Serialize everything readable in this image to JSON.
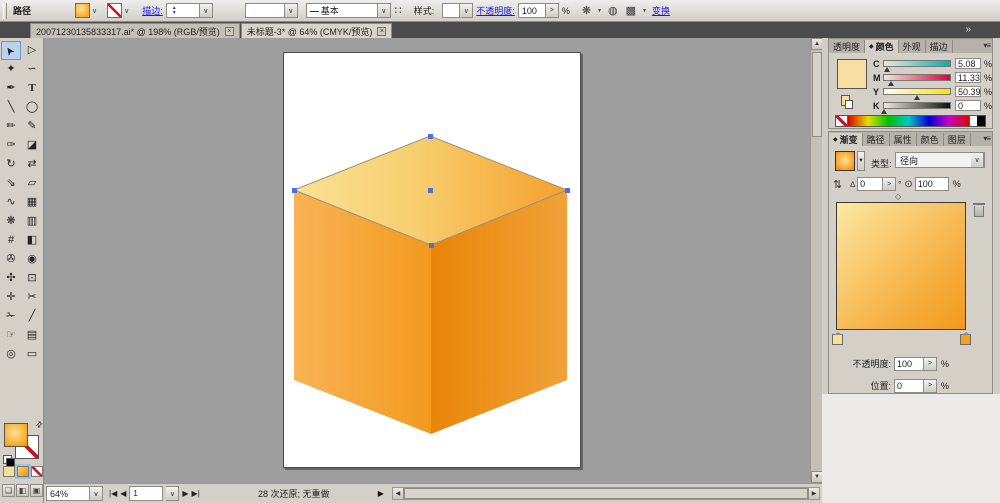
{
  "glyphs": {
    "dropdown_arrow": "∨",
    "spinner_right": ">",
    "percent": "%",
    "degree": "°",
    "menu": "▾≡",
    "collapse": "»",
    "up": "▲",
    "down": "▼",
    "nav_first": "|◀",
    "nav_prev": "◀",
    "nav_next": "▶",
    "nav_last": "▶|",
    "swap": "⇄",
    "midpoint": "◇",
    "reverse": "⇅",
    "angle": "∆",
    "aspect": "⊙",
    "active_marker": "◆",
    "brush_dots": "∷",
    "stroke_line": "—",
    "recolor": "❋",
    "sphere": "◍",
    "align_grid": "▩",
    "mode_normal": "❏",
    "mode_menu": "◧",
    "mode_full": "▣",
    "left_arrow": "◀",
    "right_arrow": "▶"
  },
  "control_bar": {
    "selection_label": "路径",
    "stroke_label": "描边:",
    "brush_name": "基本",
    "style_label": "样式:",
    "opacity_label": "不透明度:",
    "opacity_value": "100",
    "opacity_unit": "%",
    "transform_label": "变换"
  },
  "document_tabs": [
    {
      "title": "20071230135833317.ai* @ 198% (RGB/预览)",
      "close": "×"
    },
    {
      "title": "未标题-3* @ 64% (CMYK/预览)",
      "close": "×",
      "active": true
    }
  ],
  "toolbar": {
    "tools": [
      {
        "name": "selection-tool",
        "glyph": "➤",
        "active": true
      },
      {
        "name": "direct-selection-tool",
        "glyph": "▷"
      },
      {
        "name": "magic-wand-tool",
        "glyph": "✦"
      },
      {
        "name": "lasso-tool",
        "glyph": "∽"
      },
      {
        "name": "pen-tool",
        "glyph": "✒"
      },
      {
        "name": "type-tool",
        "glyph": "T"
      },
      {
        "name": "line-segment-tool",
        "glyph": "╲"
      },
      {
        "name": "ellipse-tool",
        "glyph": "◯"
      },
      {
        "name": "paintbrush-tool",
        "glyph": "✏"
      },
      {
        "name": "pencil-tool",
        "glyph": "✎"
      },
      {
        "name": "smooth-tool",
        "glyph": "✑"
      },
      {
        "name": "path-eraser-tool",
        "glyph": "◪"
      },
      {
        "name": "rotate-tool",
        "glyph": "↻"
      },
      {
        "name": "reflect-tool",
        "glyph": "⇄"
      },
      {
        "name": "scale-tool",
        "glyph": "⇘"
      },
      {
        "name": "shear-tool",
        "glyph": "▱"
      },
      {
        "name": "warp-tool",
        "glyph": "∿"
      },
      {
        "name": "free-transform-tool",
        "glyph": "▦"
      },
      {
        "name": "symbol-sprayer-tool",
        "glyph": "❋"
      },
      {
        "name": "column-graph-tool",
        "glyph": "▥"
      },
      {
        "name": "mesh-tool",
        "glyph": "#"
      },
      {
        "name": "gradient-tool",
        "glyph": "◧"
      },
      {
        "name": "eyedropper-tool",
        "glyph": "✇"
      },
      {
        "name": "blend-tool",
        "glyph": "◉"
      },
      {
        "name": "live-paint-bucket-tool",
        "glyph": "✣"
      },
      {
        "name": "live-paint-selection-tool",
        "glyph": "⊡"
      },
      {
        "name": "crop-area-tool",
        "glyph": "✛"
      },
      {
        "name": "slice-tool",
        "glyph": "✂"
      },
      {
        "name": "scissors-tool",
        "glyph": "✁"
      },
      {
        "name": "knife-tool",
        "glyph": "╱"
      },
      {
        "name": "hand-tool",
        "glyph": "☞"
      },
      {
        "name": "page-tool",
        "glyph": "▤"
      },
      {
        "name": "zoom-tool",
        "glyph": "◎"
      },
      {
        "name": "artboard-tool",
        "glyph": "▭"
      }
    ]
  },
  "status_bar": {
    "zoom_value": "64%",
    "page_value": "1",
    "undo_text": "28 次还原; 无重做"
  },
  "panels": {
    "color": {
      "tabs": [
        {
          "label": "透明度"
        },
        {
          "label": "颜色",
          "active": true
        },
        {
          "label": "外观"
        },
        {
          "label": "描边"
        }
      ],
      "swatch_color": "#F6DFA0",
      "channels": [
        {
          "label": "C",
          "value": "5.08",
          "unit": "%",
          "pct": 5
        },
        {
          "label": "M",
          "value": "11.33",
          "unit": "%",
          "pct": 11
        },
        {
          "label": "Y",
          "value": "50.39",
          "unit": "%",
          "pct": 50
        },
        {
          "label": "K",
          "value": "0",
          "unit": "%",
          "pct": 0
        }
      ]
    },
    "gradient": {
      "tabs": [
        {
          "label": "渐变",
          "active": true
        },
        {
          "label": "路径"
        },
        {
          "label": "属性"
        },
        {
          "label": "颜色"
        },
        {
          "label": "图层"
        }
      ],
      "type_label": "类型:",
      "type_value": "径向",
      "angle_value": "0",
      "aspect_value": "100",
      "opacity_label": "不透明度:",
      "opacity_value": "100",
      "location_label": "位置:",
      "location_value": "0",
      "stop_colors": [
        "#F7E392",
        "#F5A21F"
      ]
    }
  },
  "artwork": {
    "description": "orange gradient cube with selected top face",
    "top_face_gradient": [
      "#F9E294",
      "#F4A02A"
    ],
    "left_face_gradient": [
      "#F9B355",
      "#F29A1E"
    ],
    "right_face_gradient": [
      "#E98508",
      "#F0A238"
    ],
    "anchor_color": "#4D6FE0"
  }
}
